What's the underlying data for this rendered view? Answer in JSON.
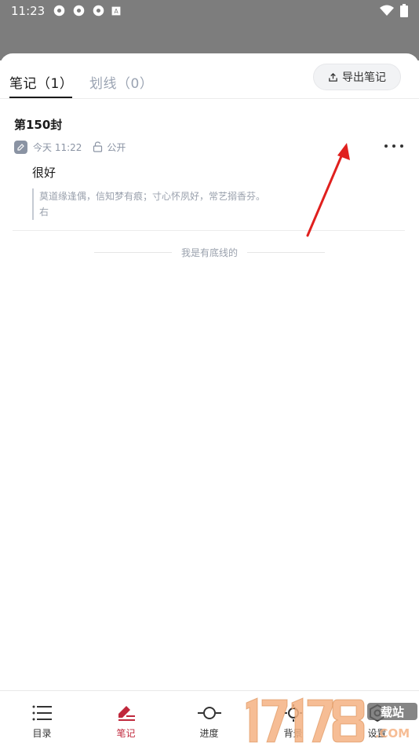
{
  "status_bar": {
    "time": "11:23",
    "left_icons": [
      "settings-icon",
      "settings-icon",
      "settings-icon",
      "a-icon"
    ],
    "right_icons": [
      "wifi-icon",
      "battery-icon"
    ]
  },
  "tabs": {
    "notes_label": "笔记（1）",
    "highlights_label": "划线（0）"
  },
  "export_button": {
    "label": "导出笔记",
    "icon": "upload-icon"
  },
  "note": {
    "title": "第150封",
    "time": "今天 11:22",
    "visibility": "公开",
    "content": "很好",
    "quote_line1": "莫道缘逢偶，信知梦有痕；寸心怀夙好，常艺搦香芬。",
    "quote_line2": "右"
  },
  "list_end_text": "我是有底线的",
  "bottom_nav": {
    "items": [
      {
        "label": "目录",
        "icon": "list-icon"
      },
      {
        "label": "笔记",
        "icon": "pen-icon"
      },
      {
        "label": "进度",
        "icon": "progress-icon"
      },
      {
        "label": "背景",
        "icon": "brightness-icon"
      },
      {
        "label": "设置",
        "icon": "settings-icon"
      }
    ],
    "active_index": 1
  },
  "colors": {
    "accent": "#c0283c",
    "annotation_arrow": "#e0201e",
    "dim_overlay": "#7d7d7d"
  }
}
